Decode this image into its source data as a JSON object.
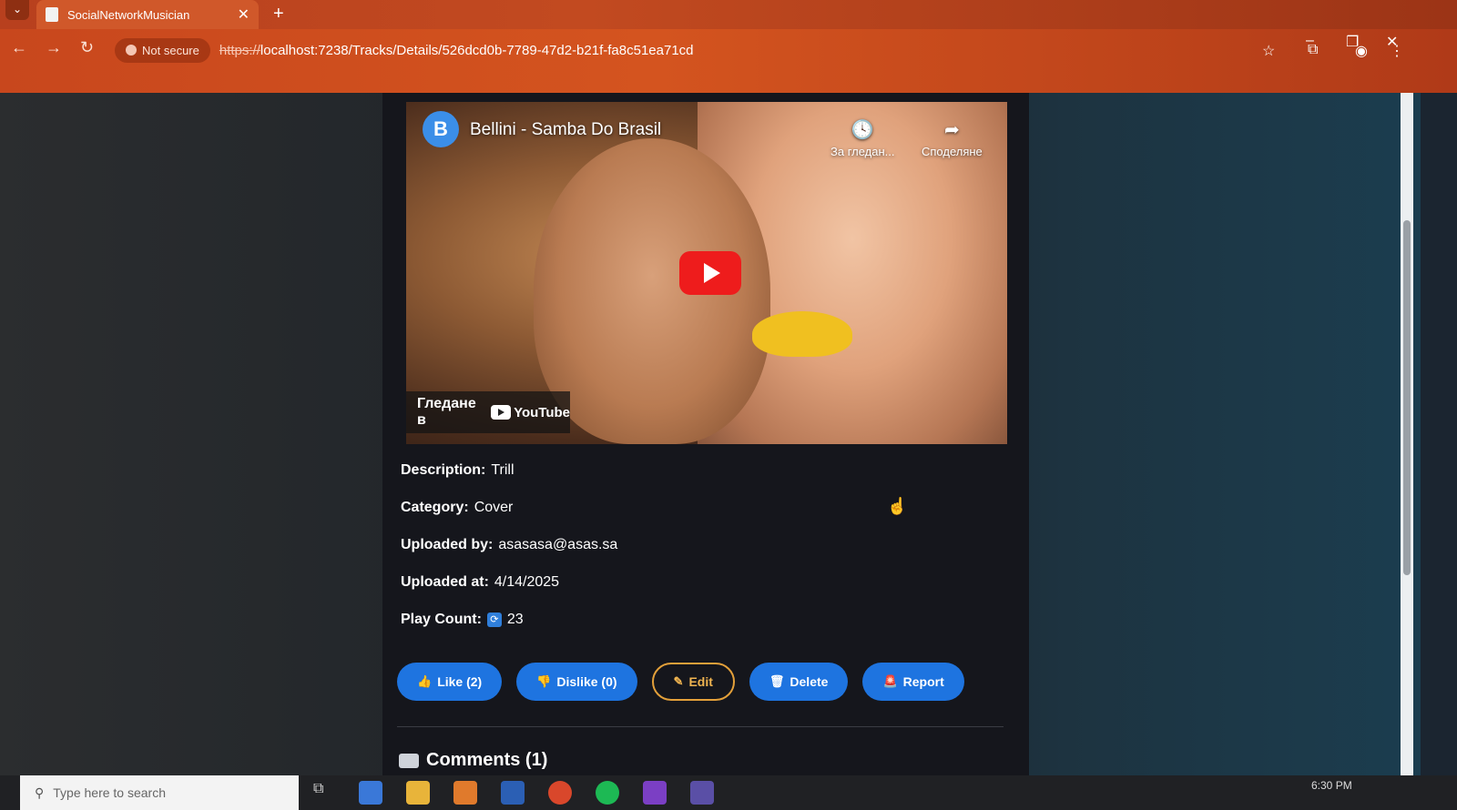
{
  "browser": {
    "tab_title": "SocialNetworkMusician",
    "security_label": "Not secure",
    "url_scheme": "https://",
    "url_rest": "localhost:7238/Tracks/Details/526dcd0b-7789-47d2-b21f-fa8c51ea71cd"
  },
  "video": {
    "channel_initial": "B",
    "title": "Bellini - Samba Do Brasil",
    "watch_later": "За гледан...",
    "share": "Споделяне",
    "watch_on": "Гледане в",
    "youtube": "YouTube"
  },
  "details": {
    "description_label": "Description:",
    "description_value": "Trill",
    "category_label": "Category:",
    "category_value": "Cover",
    "uploaded_by_label": "Uploaded by:",
    "uploaded_by_value": "asasasa@asas.sa",
    "uploaded_at_label": "Uploaded at:",
    "uploaded_at_value": "4/14/2025",
    "play_count_label": "Play Count:",
    "play_count_value": "23"
  },
  "actions": {
    "like": "Like (2)",
    "dislike": "Dislike (0)",
    "edit": "Edit",
    "delete": "Delete",
    "report": "Report"
  },
  "comments": {
    "title": "Comments (1)"
  },
  "taskbar": {
    "search_placeholder": "Type here to search",
    "time": "6:30 PM"
  },
  "colors": {
    "primary": "#1e74e0",
    "edit_outline": "#e3a03a",
    "chrome": "#c8471d"
  }
}
